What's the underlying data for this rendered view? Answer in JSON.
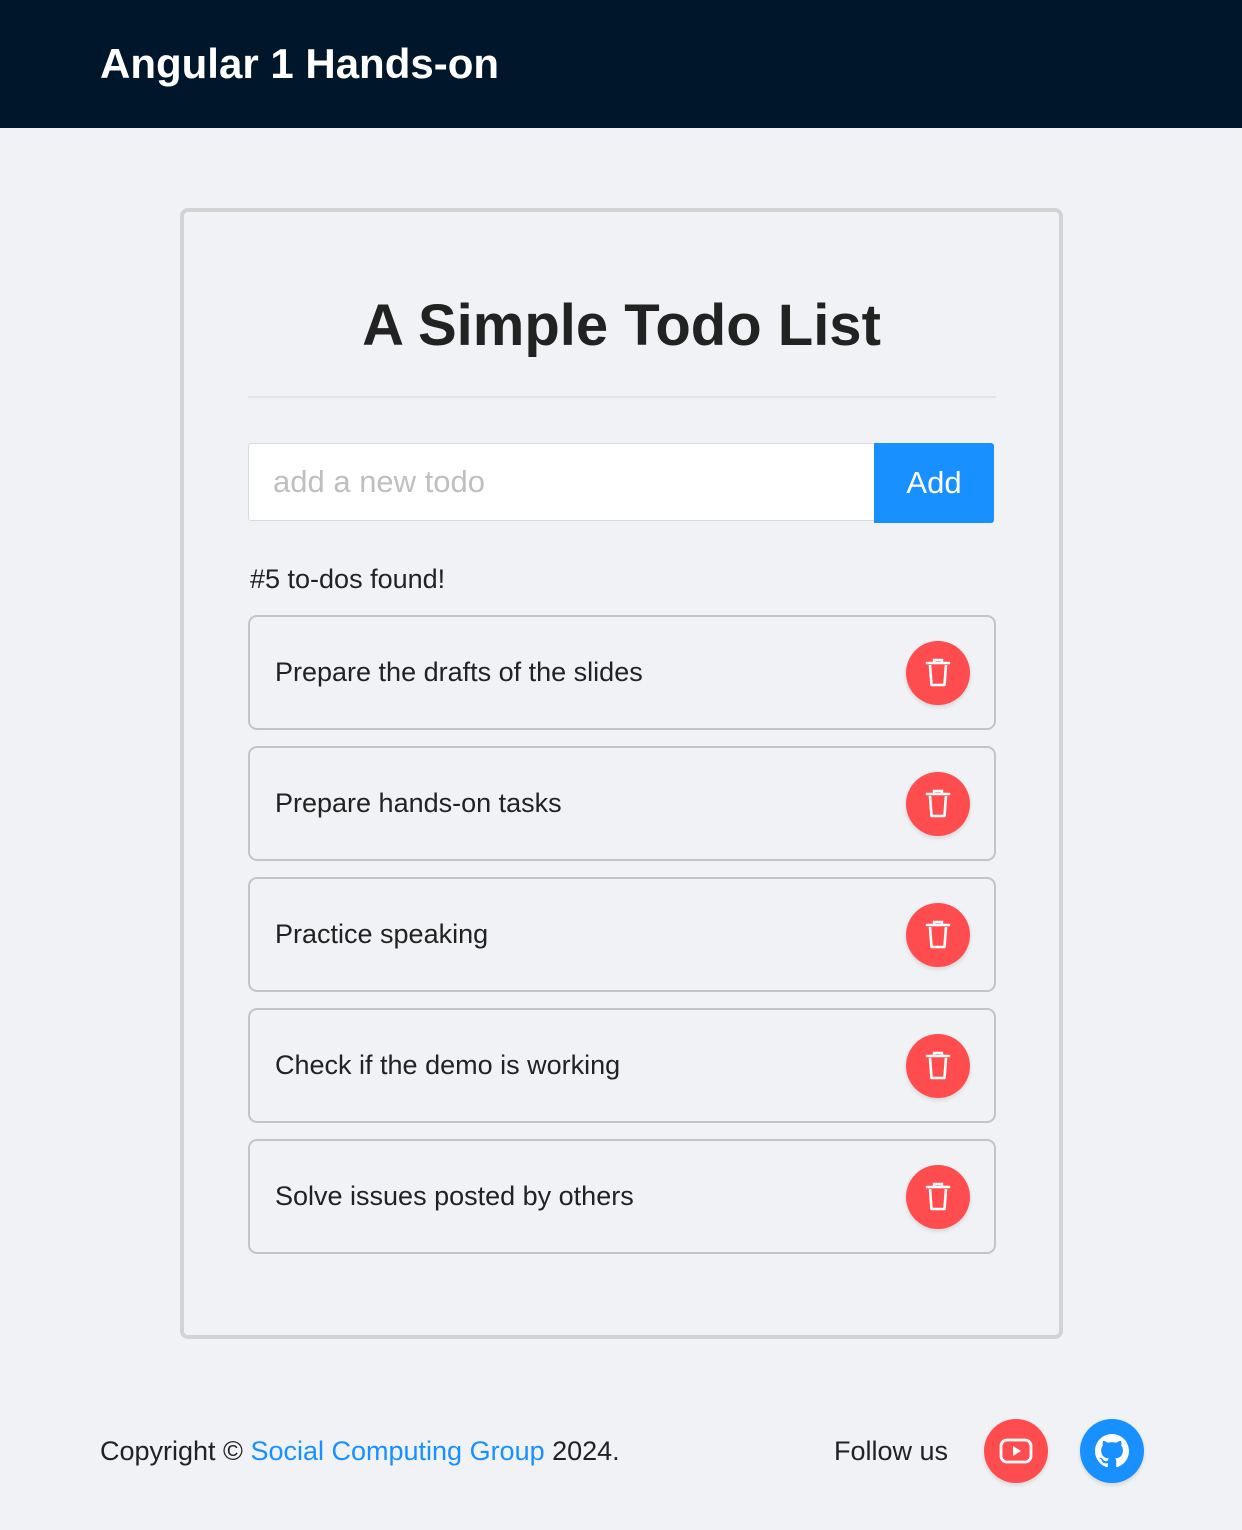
{
  "header": {
    "title": "Angular 1 Hands-on"
  },
  "main": {
    "title": "A Simple Todo List",
    "input_placeholder": "add a new todo",
    "add_label": "Add",
    "count_text": "#5 to-dos found!",
    "todos": [
      {
        "text": "Prepare the drafts of the slides",
        "icon": "trash-icon"
      },
      {
        "text": "Prepare hands-on tasks",
        "icon": "trash-icon"
      },
      {
        "text": "Practice speaking",
        "icon": "trash-icon"
      },
      {
        "text": "Check if the demo is working",
        "icon": "trash-icon"
      },
      {
        "text": "Solve issues posted by others",
        "icon": "trash-icon"
      }
    ]
  },
  "footer": {
    "copyright_prefix": "Copyright © ",
    "org_link": "Social Computing Group",
    "copyright_suffix": " 2024.",
    "follow_label": "Follow us",
    "social": [
      {
        "icon": "youtube-icon",
        "color": "#ff4d4f"
      },
      {
        "icon": "github-icon",
        "color": "#1890ff"
      }
    ]
  },
  "colors": {
    "header_bg": "#00162b",
    "page_bg": "#f0f2f5",
    "primary": "#1890ff",
    "danger": "#ff4d4f"
  }
}
